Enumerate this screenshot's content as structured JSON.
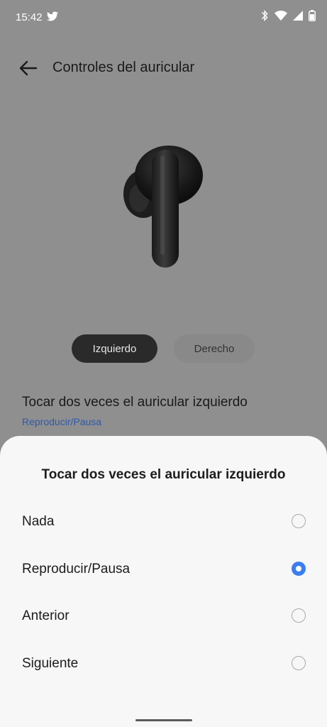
{
  "status_bar": {
    "time": "15:42"
  },
  "app_bar": {
    "title": "Controles del auricular"
  },
  "tabs": {
    "left": "Izquierdo",
    "right": "Derecho"
  },
  "setting": {
    "title": "Tocar dos veces el auricular izquierdo",
    "value": "Reproducir/Pausa"
  },
  "sheet": {
    "title": "Tocar dos veces el auricular izquierdo",
    "options": [
      {
        "label": "Nada",
        "selected": false
      },
      {
        "label": "Reproducir/Pausa",
        "selected": true
      },
      {
        "label": "Anterior",
        "selected": false
      },
      {
        "label": "Siguiente",
        "selected": false
      }
    ]
  },
  "colors": {
    "accent": "#3a7ef2",
    "link": "#2f5aa7",
    "scrim": "#8f8f8f"
  }
}
